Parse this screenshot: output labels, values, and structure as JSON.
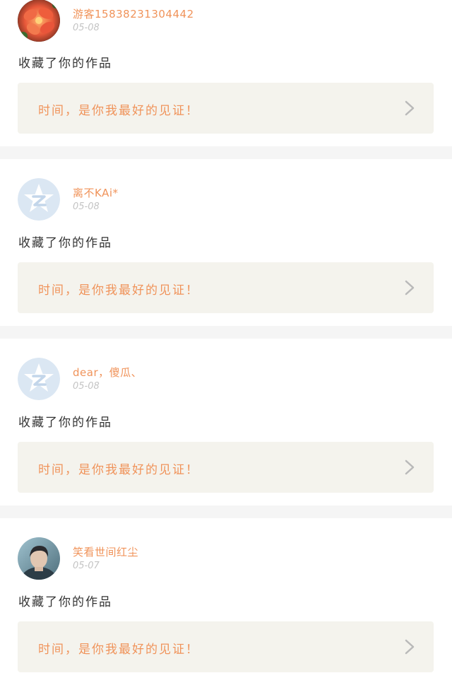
{
  "feed": {
    "items": [
      {
        "username": "游客15838231304442",
        "date": "05-08",
        "avatar": "flower-photo-avatar",
        "action": "收藏了你的作品",
        "work_title": "时间，是你我最好的见证！"
      },
      {
        "username": "离不KAi*",
        "date": "05-08",
        "avatar": "default-qq-avatar",
        "action": "收藏了你的作品",
        "work_title": "时间，是你我最好的见证！"
      },
      {
        "username": "dear，傻瓜、",
        "date": "05-08",
        "avatar": "default-qq-avatar",
        "action": "收藏了你的作品",
        "work_title": "时间，是你我最好的见证！"
      },
      {
        "username": "笑看世间红尘",
        "date": "05-07",
        "avatar": "person-photo-avatar",
        "action": "收藏了你的作品",
        "work_title": "时间，是你我最好的见证！"
      }
    ]
  },
  "colors": {
    "accent": "#f0935a",
    "link_bg": "#f4f3ed",
    "date": "#c4c4c4",
    "text": "#333333",
    "separator": "#f5f5f5"
  }
}
